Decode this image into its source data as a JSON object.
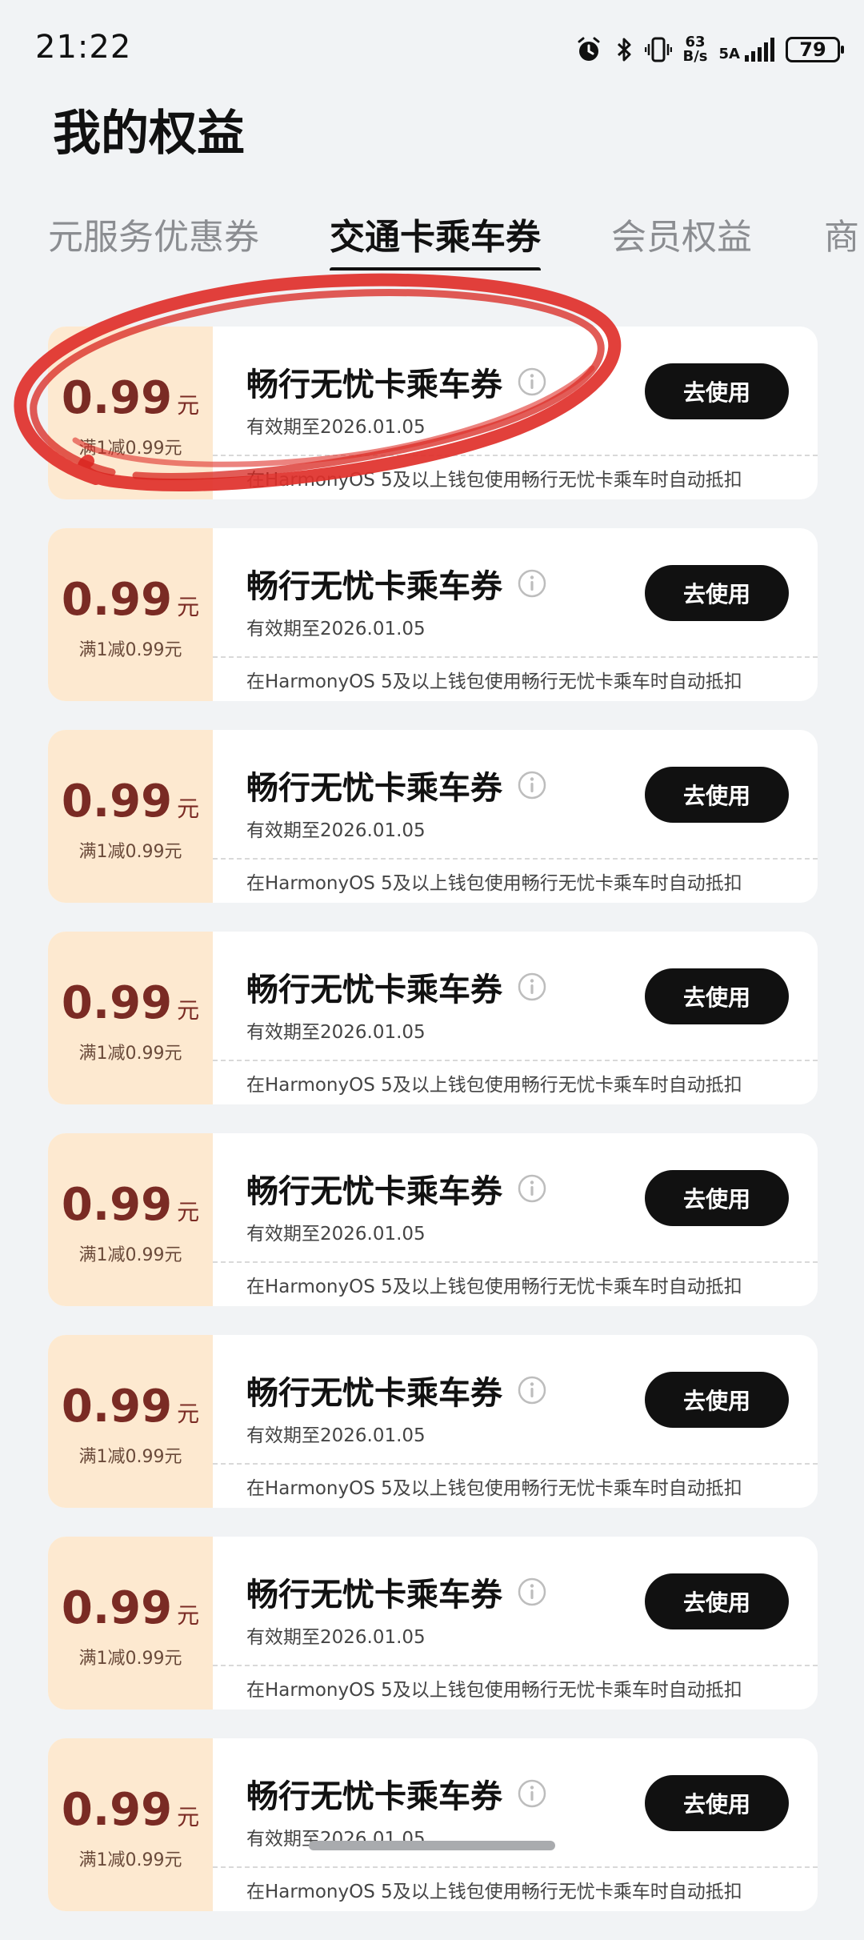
{
  "status_bar": {
    "time": "21:22",
    "net_speed_value": "63",
    "net_speed_unit": "B/s",
    "network_label": "5A",
    "battery": "79",
    "icons": [
      "alarm-icon",
      "bluetooth-icon",
      "vibrate-icon",
      "signal-icon",
      "battery-icon"
    ]
  },
  "page": {
    "title": "我的权益"
  },
  "tabs": [
    {
      "label": "元服务优惠券",
      "active": false
    },
    {
      "label": "交通卡乘车券",
      "active": true
    },
    {
      "label": "会员权益",
      "active": false
    },
    {
      "label": "商",
      "active": false
    }
  ],
  "coupons": [
    {
      "amount": "0.99",
      "unit": "元",
      "condition": "满1减0.99元",
      "title": "畅行无忧卡乘车券",
      "validity": "有效期至2026.01.05",
      "description": "在HarmonyOS 5及以上钱包使用畅行无忧卡乘车时自动抵扣",
      "button": "去使用"
    },
    {
      "amount": "0.99",
      "unit": "元",
      "condition": "满1减0.99元",
      "title": "畅行无忧卡乘车券",
      "validity": "有效期至2026.01.05",
      "description": "在HarmonyOS 5及以上钱包使用畅行无忧卡乘车时自动抵扣",
      "button": "去使用"
    },
    {
      "amount": "0.99",
      "unit": "元",
      "condition": "满1减0.99元",
      "title": "畅行无忧卡乘车券",
      "validity": "有效期至2026.01.05",
      "description": "在HarmonyOS 5及以上钱包使用畅行无忧卡乘车时自动抵扣",
      "button": "去使用"
    },
    {
      "amount": "0.99",
      "unit": "元",
      "condition": "满1减0.99元",
      "title": "畅行无忧卡乘车券",
      "validity": "有效期至2026.01.05",
      "description": "在HarmonyOS 5及以上钱包使用畅行无忧卡乘车时自动抵扣",
      "button": "去使用"
    },
    {
      "amount": "0.99",
      "unit": "元",
      "condition": "满1减0.99元",
      "title": "畅行无忧卡乘车券",
      "validity": "有效期至2026.01.05",
      "description": "在HarmonyOS 5及以上钱包使用畅行无忧卡乘车时自动抵扣",
      "button": "去使用"
    },
    {
      "amount": "0.99",
      "unit": "元",
      "condition": "满1减0.99元",
      "title": "畅行无忧卡乘车券",
      "validity": "有效期至2026.01.05",
      "description": "在HarmonyOS 5及以上钱包使用畅行无忧卡乘车时自动抵扣",
      "button": "去使用"
    },
    {
      "amount": "0.99",
      "unit": "元",
      "condition": "满1减0.99元",
      "title": "畅行无忧卡乘车券",
      "validity": "有效期至2026.01.05",
      "description": "在HarmonyOS 5及以上钱包使用畅行无忧卡乘车时自动抵扣",
      "button": "去使用"
    },
    {
      "amount": "0.99",
      "unit": "元",
      "condition": "满1减0.99元",
      "title": "畅行无忧卡乘车券",
      "validity": "有效期至2026.01.05",
      "description": "在HarmonyOS 5及以上钱包使用畅行无忧卡乘车时自动抵扣",
      "button": "去使用"
    }
  ],
  "colors": {
    "background": "#f1f3f5",
    "coupon_left_bg": "#fde9d0",
    "amount_color": "#7a2b24",
    "button_bg": "#111111",
    "annotation": "#e0302a"
  }
}
